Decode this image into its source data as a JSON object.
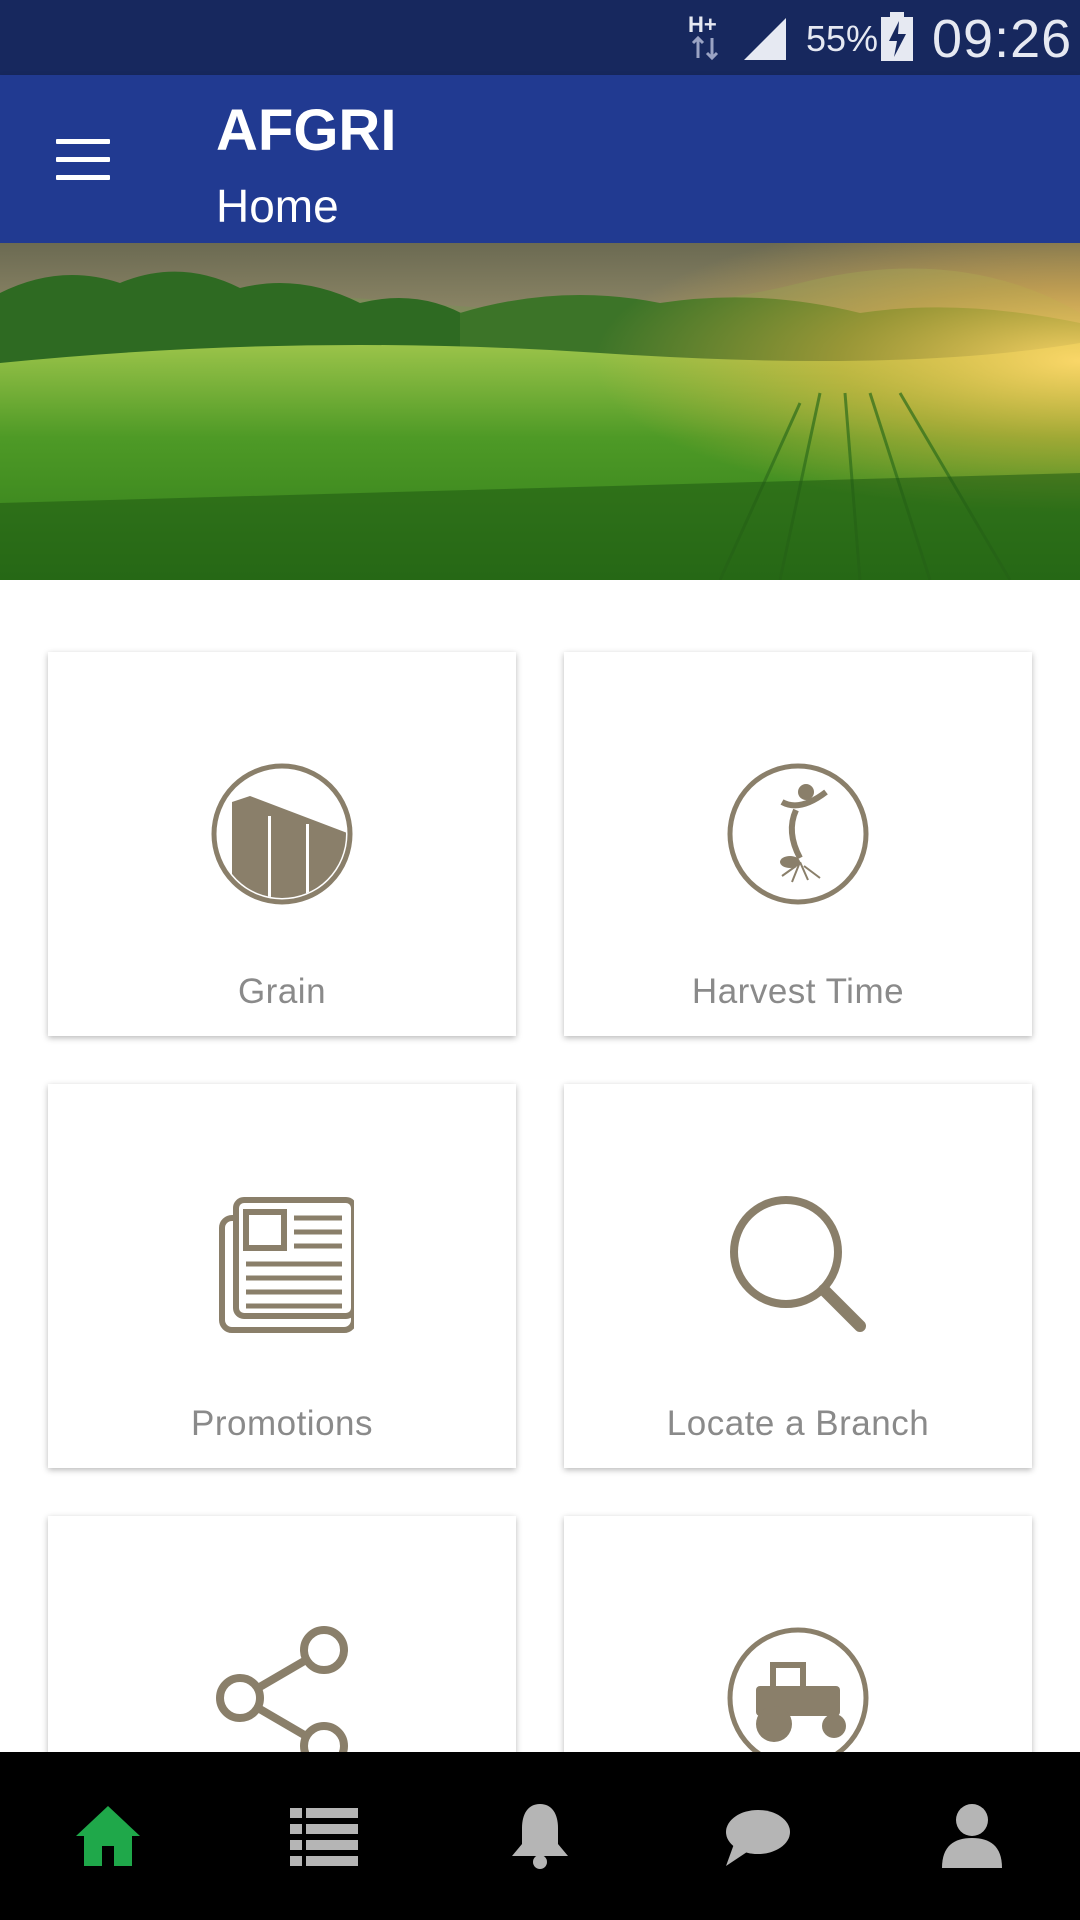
{
  "status_bar": {
    "network_type": "H+",
    "battery_percent": "55%",
    "time": "09:26",
    "icons": [
      "network-type-icon",
      "signal-icon",
      "battery-charging-icon"
    ]
  },
  "app_bar": {
    "title": "AFGRI",
    "subtitle": "Home",
    "menu_icon": "hamburger-menu-icon"
  },
  "hero": {
    "image": "farm-field-banner"
  },
  "tiles": [
    {
      "label": "Grain",
      "icon": "grain-silo-icon"
    },
    {
      "label": "Harvest Time",
      "icon": "sprout-figure-icon"
    },
    {
      "label": "Promotions",
      "icon": "newspaper-icon"
    },
    {
      "label": "Locate a Branch",
      "icon": "search-icon"
    },
    {
      "label": "",
      "icon": "share-icon"
    },
    {
      "label": "",
      "icon": "tractor-icon"
    }
  ],
  "bottom_nav": {
    "items": [
      {
        "name": "home",
        "icon": "home-icon",
        "active": true
      },
      {
        "name": "list",
        "icon": "list-icon",
        "active": false
      },
      {
        "name": "notifications",
        "icon": "bell-icon",
        "active": false
      },
      {
        "name": "messages",
        "icon": "chat-icon",
        "active": false
      },
      {
        "name": "profile",
        "icon": "user-icon",
        "active": false
      }
    ],
    "active_color": "#1fa84a",
    "inactive_color": "#b5b5b5"
  },
  "colors": {
    "status_bar": "#17285e",
    "app_bar": "#213a91",
    "icon_tint": "#8a7f6a"
  }
}
